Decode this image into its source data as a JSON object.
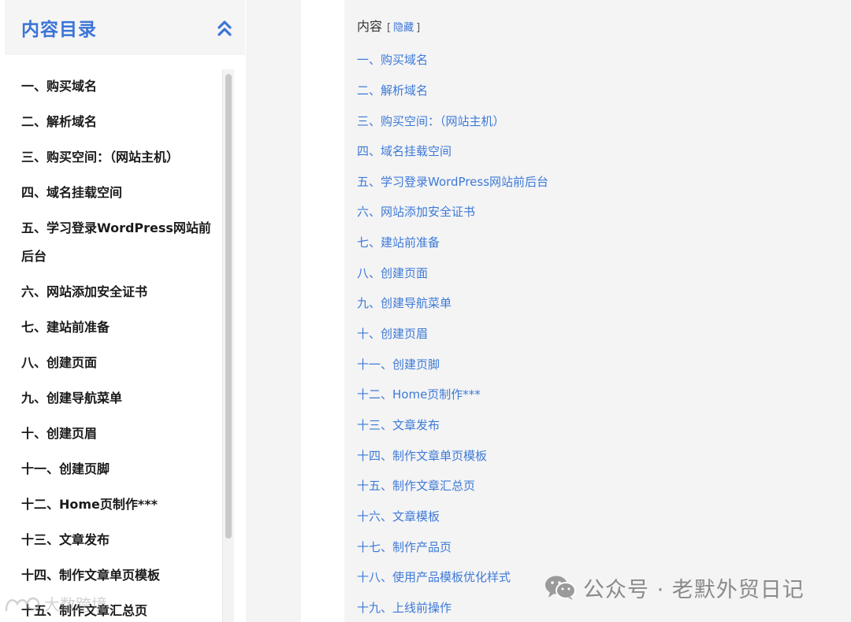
{
  "left_toc": {
    "title": "内容目录",
    "collapse_icon": "double-chevron-up-icon",
    "items": [
      "一、购买域名",
      "二、解析域名",
      "三、购买空间：（网站主机）",
      "四、域名挂载空间",
      "五、学习登录WordPress网站前后台",
      "六、网站添加安全证书",
      "七、建站前准备",
      "八、创建页面",
      "九、创建导航菜单",
      "十、创建页眉",
      "十一、创建页脚",
      "十二、Home页制作***",
      "十三、文章发布",
      "十四、制作文章单页模板",
      "十五、制作文章汇总页"
    ]
  },
  "right_toc": {
    "title": "内容",
    "bracket_open": "[",
    "toggle_label": "隐藏",
    "bracket_close": "]",
    "items": [
      "一、购买域名",
      "二、解析域名",
      "三、购买空间：（网站主机）",
      "四、域名挂载空间",
      "五、学习登录WordPress网站前后台",
      "六、网站添加安全证书",
      "七、建站前准备",
      "八、创建页面",
      "九、创建导航菜单",
      "十、创建页眉",
      "十一、创建页脚",
      "十二、Home页制作***",
      "十三、文章发布",
      "十四、制作文章单页模板",
      "十五、制作文章汇总页",
      "十六、文章模板",
      "十七、制作产品页",
      "十八、使用产品模板优化样式",
      "十九、上线前操作"
    ]
  },
  "watermarks": {
    "right_text": "公众号 · 老默外贸日记",
    "right_icon": "wechat-icon",
    "left_text": "大数跨境",
    "left_icon": "brand-logo-icon"
  },
  "colors": {
    "accent": "#3b74d6",
    "link": "#3d7ad6"
  }
}
